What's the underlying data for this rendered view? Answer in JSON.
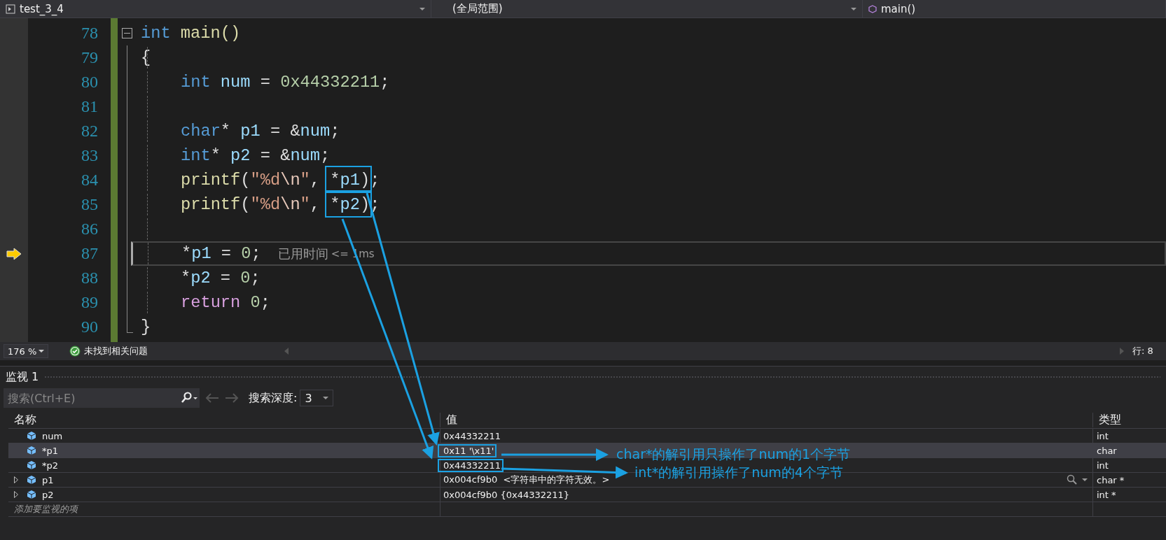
{
  "navigation_bar": {
    "project": "test_3_4",
    "scope": "(全局范围)",
    "member": "main()"
  },
  "editor": {
    "lines": [
      {
        "number": "78",
        "kind": "fold_start",
        "current": false,
        "indented": false,
        "segments": [
          {
            "tokens": [
              {
                "text": "int",
                "kind": "keyword"
              },
              {
                "text": " main()",
                "kind": "function"
              }
            ]
          }
        ]
      },
      {
        "number": "79",
        "kind": "body",
        "current": false,
        "indented": false,
        "segments": [
          {
            "tokens": [
              {
                "text": "{",
                "kind": "plain"
              }
            ]
          }
        ]
      },
      {
        "number": "80",
        "kind": "body",
        "current": false,
        "indented": true,
        "segments": [
          {
            "tokens": [
              {
                "text": "int",
                "kind": "keyword"
              },
              {
                "text": " num",
                "kind": "variable"
              },
              {
                "text": " = ",
                "kind": "plain"
              },
              {
                "text": "0x44332211",
                "kind": "number"
              },
              {
                "text": ";",
                "kind": "plain"
              }
            ]
          }
        ]
      },
      {
        "number": "81",
        "kind": "body",
        "current": false
      },
      {
        "number": "82",
        "kind": "body",
        "current": false,
        "indented": true,
        "segments": [
          {
            "tokens": [
              {
                "text": "char",
                "kind": "keyword"
              },
              {
                "text": "* ",
                "kind": "plain"
              },
              {
                "text": "p1",
                "kind": "variable"
              },
              {
                "text": " = &",
                "kind": "plain"
              },
              {
                "text": "num",
                "kind": "variable"
              },
              {
                "text": ";",
                "kind": "plain"
              }
            ]
          }
        ]
      },
      {
        "number": "83",
        "kind": "body",
        "current": false,
        "indented": true,
        "segments": [
          {
            "tokens": [
              {
                "text": "int",
                "kind": "keyword"
              },
              {
                "text": "* ",
                "kind": "plain"
              },
              {
                "text": "p2",
                "kind": "variable"
              },
              {
                "text": " = &",
                "kind": "plain"
              },
              {
                "text": "num",
                "kind": "variable"
              },
              {
                "text": ";",
                "kind": "plain"
              }
            ]
          }
        ]
      },
      {
        "number": "84",
        "kind": "body",
        "current": false,
        "indented": true,
        "segments": [
          {
            "highlighted": false,
            "tokens": [
              {
                "text": "printf",
                "kind": "function"
              },
              {
                "text": "(",
                "kind": "plain"
              },
              {
                "text": "\"%d",
                "kind": "string"
              },
              {
                "text": "\\n",
                "kind": "escape"
              },
              {
                "text": "\"",
                "kind": "string"
              },
              {
                "text": ", ",
                "kind": "plain"
              }
            ]
          },
          {
            "highlighted": true,
            "tokens": [
              {
                "text": "*",
                "kind": "plain"
              },
              {
                "text": "p1",
                "kind": "variable"
              },
              {
                "text": ")",
                "kind": "plain"
              }
            ]
          },
          {
            "highlighted": false,
            "tokens": [
              {
                "text": ";",
                "kind": "plain"
              }
            ]
          }
        ]
      },
      {
        "number": "85",
        "kind": "body",
        "current": false,
        "indented": true,
        "segments": [
          {
            "highlighted": false,
            "tokens": [
              {
                "text": "printf",
                "kind": "function"
              },
              {
                "text": "(",
                "kind": "plain"
              },
              {
                "text": "\"%d",
                "kind": "string"
              },
              {
                "text": "\\n",
                "kind": "escape"
              },
              {
                "text": "\"",
                "kind": "string"
              },
              {
                "text": ", ",
                "kind": "plain"
              }
            ]
          },
          {
            "highlighted": true,
            "tokens": [
              {
                "text": "*",
                "kind": "plain"
              },
              {
                "text": "p2",
                "kind": "variable"
              },
              {
                "text": ")",
                "kind": "plain"
              }
            ]
          },
          {
            "highlighted": false,
            "tokens": [
              {
                "text": ";",
                "kind": "plain"
              }
            ]
          }
        ]
      },
      {
        "number": "86",
        "kind": "body",
        "current": false
      },
      {
        "number": "87",
        "kind": "body",
        "current": true,
        "indented": true,
        "segments": [
          {
            "tokens": [
              {
                "text": "*",
                "kind": "plain"
              },
              {
                "text": "p1",
                "kind": "variable"
              },
              {
                "text": " = ",
                "kind": "plain"
              },
              {
                "text": "0",
                "kind": "number"
              },
              {
                "text": ";",
                "kind": "plain"
              }
            ]
          }
        ],
        "hint": {
          "label": "已用时间",
          "value": "<= 1ms"
        }
      },
      {
        "number": "88",
        "kind": "body",
        "current": false,
        "indented": true,
        "segments": [
          {
            "tokens": [
              {
                "text": "*",
                "kind": "plain"
              },
              {
                "text": "p2",
                "kind": "variable"
              },
              {
                "text": " = ",
                "kind": "plain"
              },
              {
                "text": "0",
                "kind": "number"
              },
              {
                "text": ";",
                "kind": "plain"
              }
            ]
          }
        ]
      },
      {
        "number": "89",
        "kind": "body",
        "current": false,
        "indented": true,
        "segments": [
          {
            "tokens": [
              {
                "text": "return",
                "kind": "control"
              },
              {
                "text": " 0",
                "kind": "number"
              },
              {
                "text": ";",
                "kind": "plain"
              }
            ]
          }
        ]
      },
      {
        "number": "90",
        "kind": "fold_end",
        "current": false,
        "indented": false,
        "segments": [
          {
            "tokens": [
              {
                "text": "}",
                "kind": "plain"
              }
            ]
          }
        ]
      }
    ]
  },
  "status_bar": {
    "zoom": "176 %",
    "issues": "未找到相关问题",
    "position": "行: 8"
  },
  "watch": {
    "title": "监视 1",
    "search": {
      "placeholder": "搜索(Ctrl+E)"
    },
    "depth_label": "搜索深度:",
    "depth": "3",
    "columns": [
      "名称",
      "值",
      "类型"
    ],
    "rows": [
      {
        "name": "num",
        "value": "0x44332211",
        "type": "int",
        "expandable": false,
        "selected": false,
        "visualizer": false,
        "highlighted": false
      },
      {
        "name": "*p1",
        "value": "0x11 '\\x11'",
        "type": "char",
        "expandable": false,
        "selected": true,
        "visualizer": false,
        "highlighted": true
      },
      {
        "name": "*p2",
        "value": "0x44332211",
        "type": "int",
        "expandable": false,
        "selected": false,
        "visualizer": false,
        "highlighted": true
      },
      {
        "name": "p1",
        "value": "0x004cf9b0  <字符串中的字符无效。>",
        "type": "char *",
        "expandable": true,
        "selected": false,
        "visualizer": true,
        "highlighted": false
      },
      {
        "name": "p2",
        "value": "0x004cf9b0 {0x44332211}",
        "type": "int *",
        "expandable": true,
        "selected": false,
        "visualizer": false,
        "highlighted": false
      }
    ],
    "add_placeholder": "添加要监视的项"
  },
  "annotations": [
    "char*的解引用只操作了num的1个字节",
    "int*的解引用操作了num的4个字节"
  ]
}
